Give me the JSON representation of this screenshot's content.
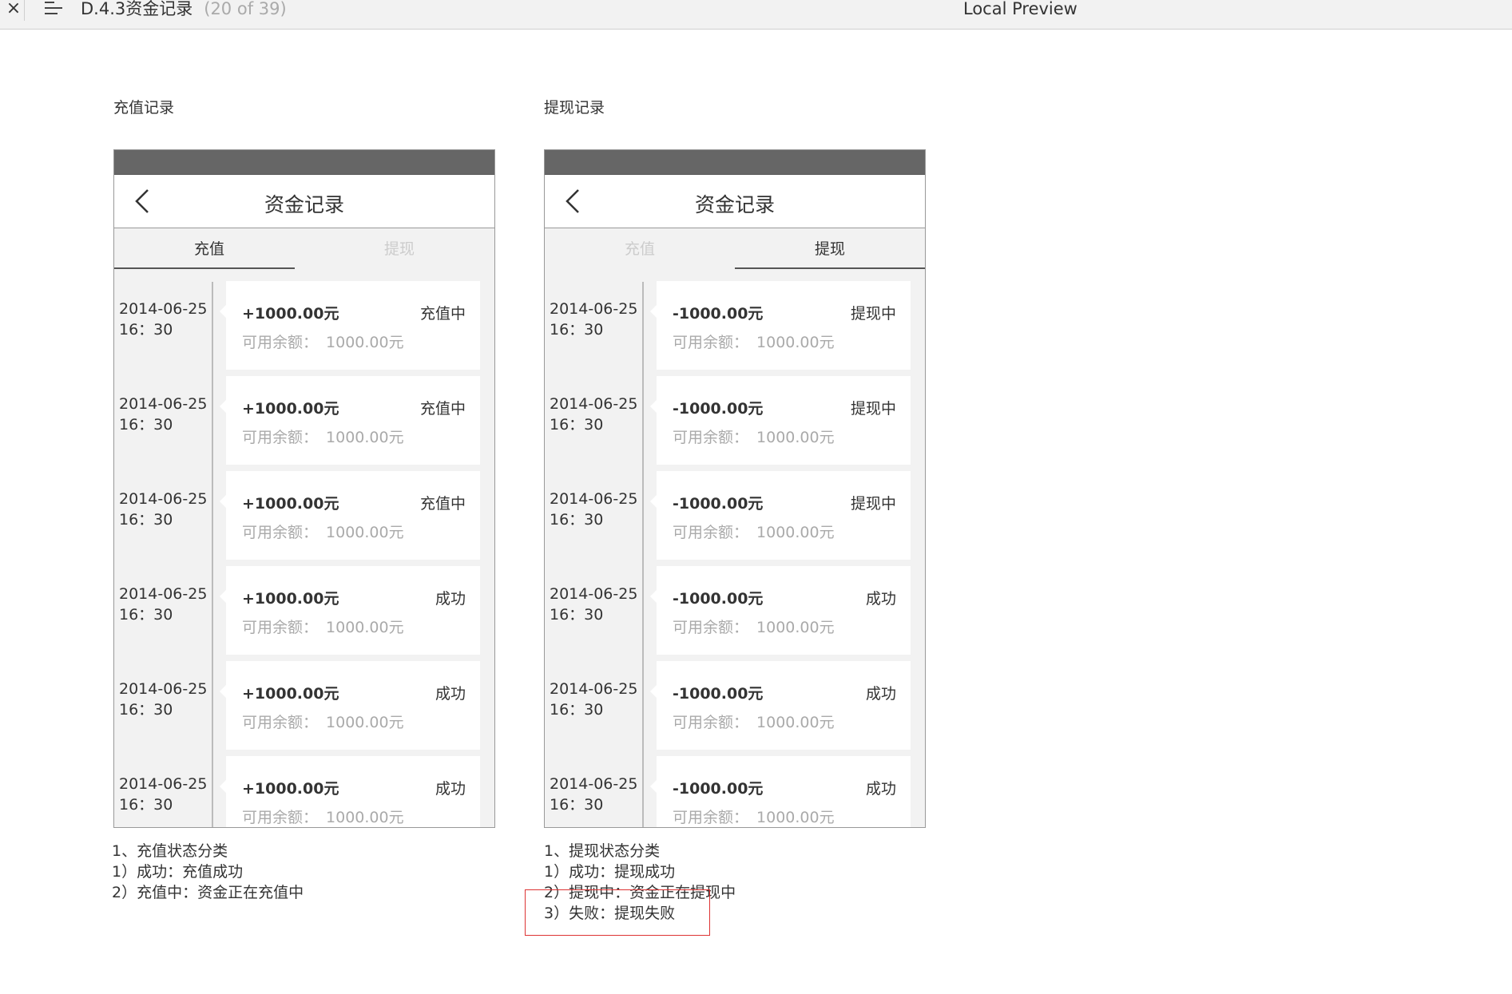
{
  "topbar": {
    "close_glyph": "×",
    "doc_title": "D.4.3资金记录",
    "doc_count": "(20 of 39)",
    "preview_title": "Local Preview"
  },
  "panels": [
    {
      "section_label": "充值记录",
      "nav_title": "资金记录",
      "tabs": [
        "充值",
        "提现"
      ],
      "active_tab": 0,
      "balance_label": "可用余额：",
      "records": [
        {
          "date": "2014-06-25",
          "time": "16：30",
          "amount": "+1000.00元",
          "status": "充值中",
          "balance": "1000.00元"
        },
        {
          "date": "2014-06-25",
          "time": "16：30",
          "amount": "+1000.00元",
          "status": "充值中",
          "balance": "1000.00元"
        },
        {
          "date": "2014-06-25",
          "time": "16：30",
          "amount": "+1000.00元",
          "status": "充值中",
          "balance": "1000.00元"
        },
        {
          "date": "2014-06-25",
          "time": "16：30",
          "amount": "+1000.00元",
          "status": "成功",
          "balance": "1000.00元"
        },
        {
          "date": "2014-06-25",
          "time": "16：30",
          "amount": "+1000.00元",
          "status": "成功",
          "balance": "1000.00元"
        },
        {
          "date": "2014-06-25",
          "time": "16：30",
          "amount": "+1000.00元",
          "status": "成功",
          "balance": "1000.00元"
        }
      ],
      "notes": [
        "1、充值状态分类",
        "1）成功：充值成功",
        "2）充值中：资金正在充值中"
      ]
    },
    {
      "section_label": "提现记录",
      "nav_title": "资金记录",
      "tabs": [
        "充值",
        "提现"
      ],
      "active_tab": 1,
      "balance_label": "可用余额：",
      "records": [
        {
          "date": "2014-06-25",
          "time": "16：30",
          "amount": "-1000.00元",
          "status": "提现中",
          "balance": "1000.00元"
        },
        {
          "date": "2014-06-25",
          "time": "16：30",
          "amount": "-1000.00元",
          "status": "提现中",
          "balance": "1000.00元"
        },
        {
          "date": "2014-06-25",
          "time": "16：30",
          "amount": "-1000.00元",
          "status": "提现中",
          "balance": "1000.00元"
        },
        {
          "date": "2014-06-25",
          "time": "16：30",
          "amount": "-1000.00元",
          "status": "成功",
          "balance": "1000.00元"
        },
        {
          "date": "2014-06-25",
          "time": "16：30",
          "amount": "-1000.00元",
          "status": "成功",
          "balance": "1000.00元"
        },
        {
          "date": "2014-06-25",
          "time": "16：30",
          "amount": "-1000.00元",
          "status": "成功",
          "balance": "1000.00元"
        }
      ],
      "notes": [
        "1、提现状态分类",
        "1）成功：提现成功",
        "2）提现中：资金正在提现中",
        "3）失败：提现失败"
      ]
    }
  ],
  "colors": {
    "status_bar": "#666666",
    "page_bg": "#f2f2f2",
    "highlight_border": "#dd3333"
  }
}
